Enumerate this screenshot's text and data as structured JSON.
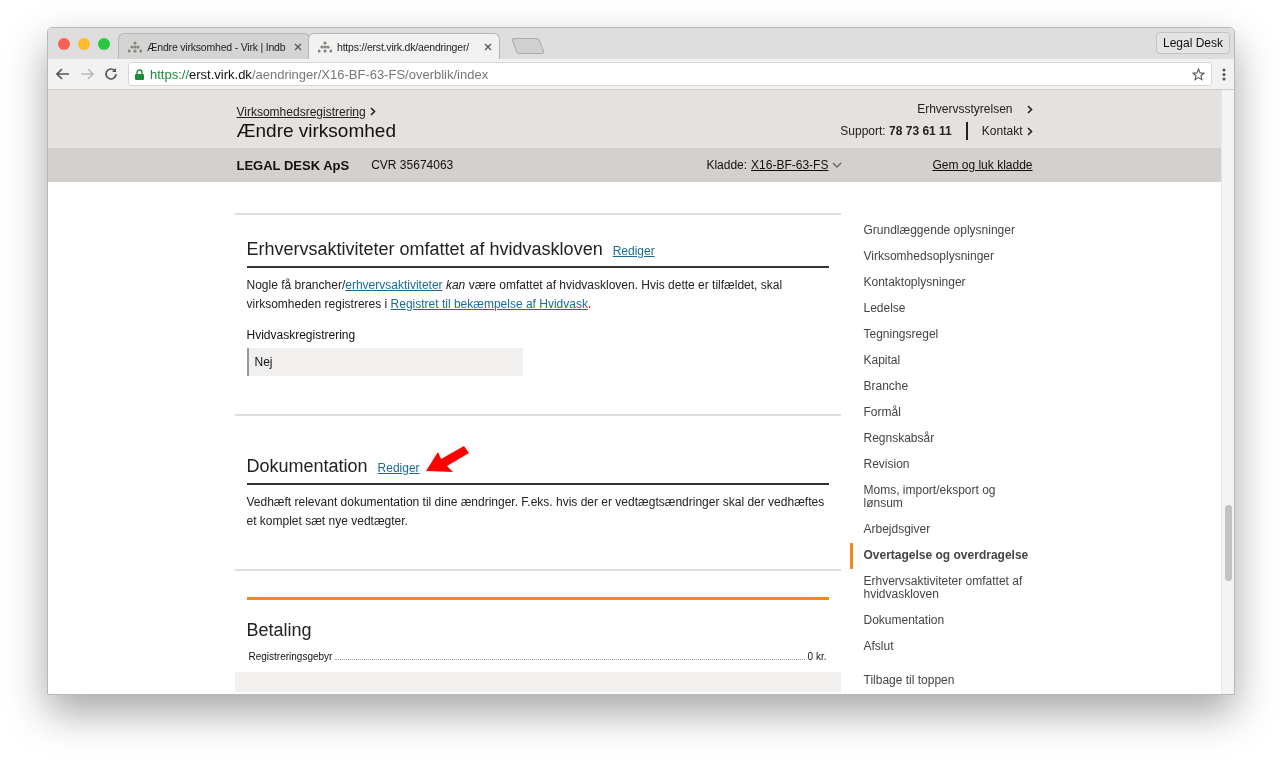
{
  "browser": {
    "tabs": [
      {
        "title": "Ændre virksomhed - Virk | Indb",
        "selected": false
      },
      {
        "title": "https://erst.virk.dk/aendringer/",
        "selected": true
      }
    ],
    "profile": "Legal Desk",
    "url": {
      "scheme": "https://",
      "host": "erst.virk.dk",
      "path": "/aendringer/X16-BF-63-FS/overblik/index"
    }
  },
  "header": {
    "breadcrumb": "Virksomhedsregistrering",
    "title": "Ændre virksomhed",
    "agency": "Erhvervsstyrelsen",
    "support_label": "Support:",
    "support_phone": "78 73 61 11",
    "contact": "Kontakt"
  },
  "company_bar": {
    "name": "LEGAL DESK ApS",
    "cvr": "CVR 35674063",
    "draft_label": "Kladde:",
    "draft_id": "X16-BF-63-FS",
    "save": "Gem og luk kladde"
  },
  "sections": [
    {
      "title": "Erhvervsaktiviteter omfattet af hvidvaskloven",
      "edit": "Rediger",
      "annotated": false,
      "paragraph": [
        {
          "kind": "text",
          "text": "Nogle få brancher/"
        },
        {
          "kind": "link",
          "text": "erhvervsaktiviteter"
        },
        {
          "kind": "em",
          "text": " kan "
        },
        {
          "kind": "text",
          "text": "være omfattet af hvidvaskloven. Hvis dette er tilfældet, skal virksomheden registreres i "
        },
        {
          "kind": "link",
          "text": "Registret til bekæmpelse af Hvidvask"
        },
        {
          "kind": "text",
          "text": "."
        }
      ],
      "field": {
        "label": "Hvidvaskregistrering",
        "value": "Nej"
      }
    },
    {
      "title": "Dokumentation",
      "edit": "Rediger",
      "annotated": true,
      "paragraph": [
        {
          "kind": "text",
          "text": "Vedhæft relevant dokumentation til dine ændringer. F.eks. hvis der er vedtægtsændringer skal der vedhæftes et komplet sæt nye vedtægter."
        }
      ]
    }
  ],
  "payment": {
    "title": "Betaling",
    "rows": [
      {
        "label": "Registreringsgebyr",
        "amount": "0 kr."
      }
    ]
  },
  "nav": {
    "items": [
      {
        "label": "Grundlæggende oplysninger",
        "selected": false
      },
      {
        "label": "Virksomhedsoplysninger",
        "selected": false
      },
      {
        "label": "Kontaktoplysninger",
        "selected": false
      },
      {
        "label": "Ledelse",
        "selected": false
      },
      {
        "label": "Tegningsregel",
        "selected": false
      },
      {
        "label": "Kapital",
        "selected": false
      },
      {
        "label": "Branche",
        "selected": false
      },
      {
        "label": "Formål",
        "selected": false
      },
      {
        "label": "Regnskabsår",
        "selected": false
      },
      {
        "label": "Revision",
        "selected": false
      },
      {
        "label": "Moms, import/eksport og lønsum",
        "selected": false
      },
      {
        "label": "Arbejdsgiver",
        "selected": false
      },
      {
        "label": "Overtagelse og overdragelse",
        "selected": true
      },
      {
        "label": "Erhvervsaktiviteter omfattet af hvidvaskloven",
        "selected": false
      },
      {
        "label": "Dokumentation",
        "selected": false
      },
      {
        "label": "Afslut",
        "selected": false
      }
    ],
    "back_to_top": "Tilbage til toppen"
  }
}
